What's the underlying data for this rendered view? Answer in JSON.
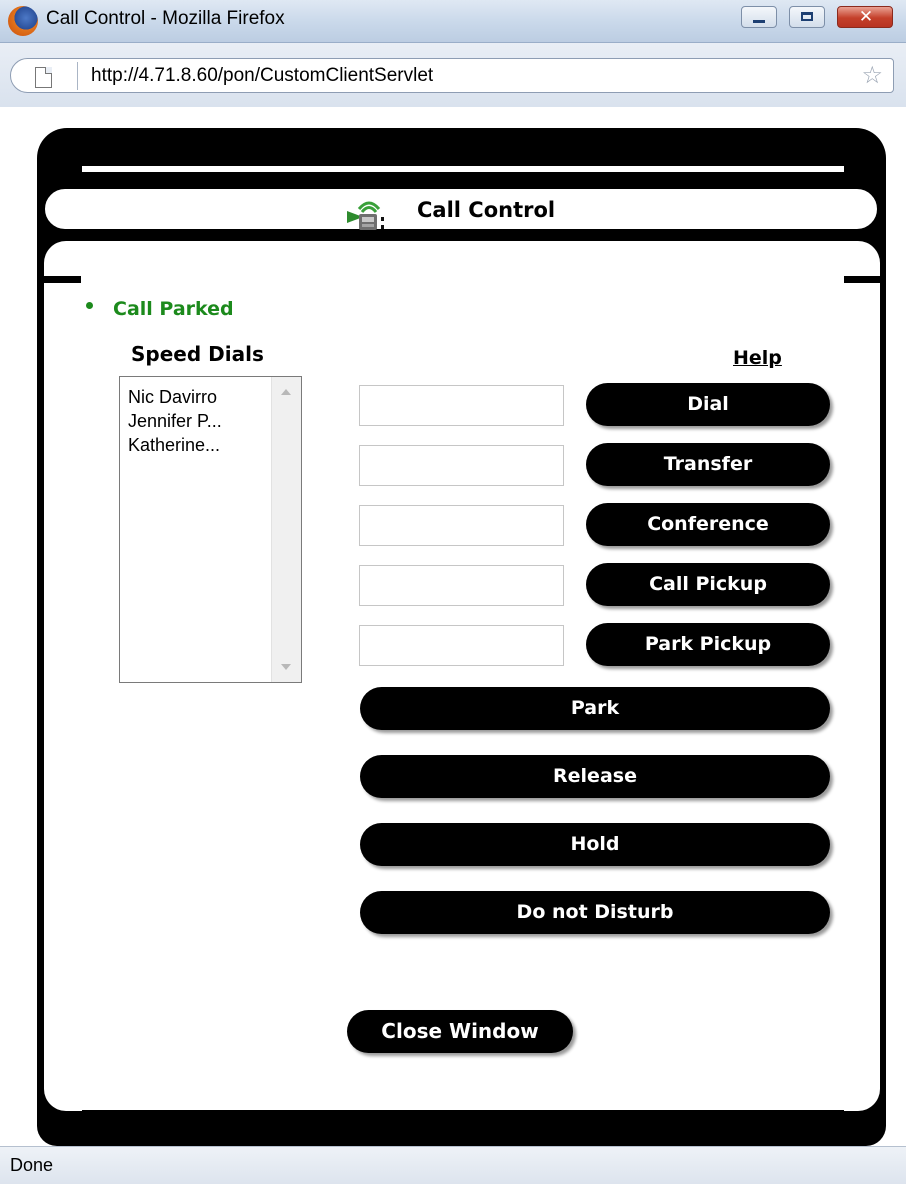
{
  "window": {
    "title": "Call Control - Mozilla Firefox",
    "close_glyph": "✕",
    "url": "http://4.71.8.60/pon/CustomClientServlet",
    "star_glyph": "☆"
  },
  "panel": {
    "title": "Call Control",
    "status": "Call Parked",
    "status_color": "#1c8a1c",
    "speed_dials_title": "Speed Dials",
    "help_label": "Help",
    "speed_dials": [
      "Nic Davirro",
      "Jennifer P...",
      "Katherine..."
    ],
    "inputs": [
      {
        "value": ""
      },
      {
        "value": ""
      },
      {
        "value": ""
      },
      {
        "value": ""
      },
      {
        "value": ""
      }
    ],
    "buttons": {
      "dial": "Dial",
      "transfer": "Transfer",
      "conference": "Conference",
      "call_pickup": "Call Pickup",
      "park_pickup": "Park Pickup",
      "park": "Park",
      "release": "Release",
      "hold": "Hold",
      "do_not_disturb": "Do not Disturb",
      "close_window": "Close Window"
    }
  },
  "statusbar": {
    "text": "Done"
  }
}
